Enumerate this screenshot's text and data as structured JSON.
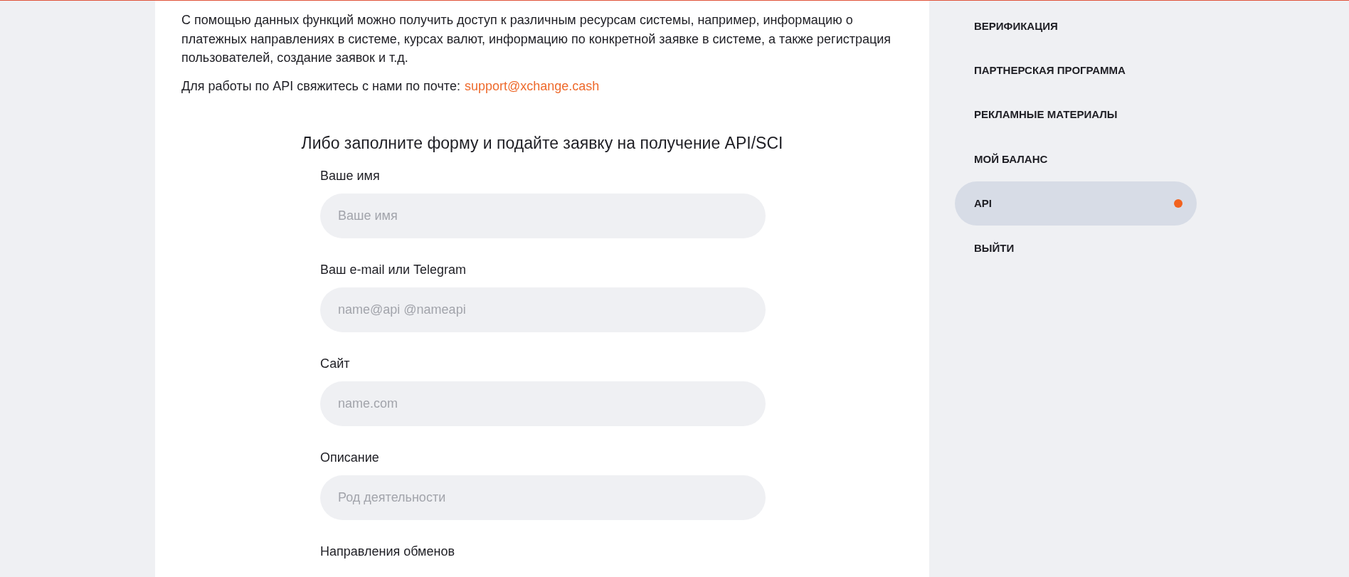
{
  "intro": {
    "paragraph": "С помощью данных функций можно получить доступ к различным ресурсам системы, например, информацию о платежных направлениях в системе, курсах валют, информацию по конкретной заявке в системе, а также регистрация пользователей, создание заявок и т.д.",
    "contact_text": "Для работы по API свяжитесь с нами по почте:",
    "contact_email": "support@xchange.cash"
  },
  "form": {
    "title": "Либо заполните форму и подайте заявку на получение API/SCI",
    "fields": [
      {
        "label": "Ваше имя",
        "placeholder": "Ваше имя"
      },
      {
        "label": "Ваш e-mail или Telegram",
        "placeholder": "name@api @nameapi"
      },
      {
        "label": "Сайт",
        "placeholder": "name.com"
      },
      {
        "label": "Описание",
        "placeholder": "Род деятельности"
      }
    ],
    "next_label": "Направления обменов"
  },
  "sidebar": {
    "items": [
      {
        "label": "ВЕРИФИКАЦИЯ",
        "selected": false
      },
      {
        "label": "ПАРТНЕРСКАЯ ПРОГРАММА",
        "selected": false
      },
      {
        "label": "РЕКЛАМНЫЕ МАТЕРИАЛЫ",
        "selected": false
      },
      {
        "label": "МОЙ БАЛАНС",
        "selected": false
      },
      {
        "label": "API",
        "selected": true
      },
      {
        "label": "ВЫЙТИ",
        "selected": false
      }
    ]
  }
}
